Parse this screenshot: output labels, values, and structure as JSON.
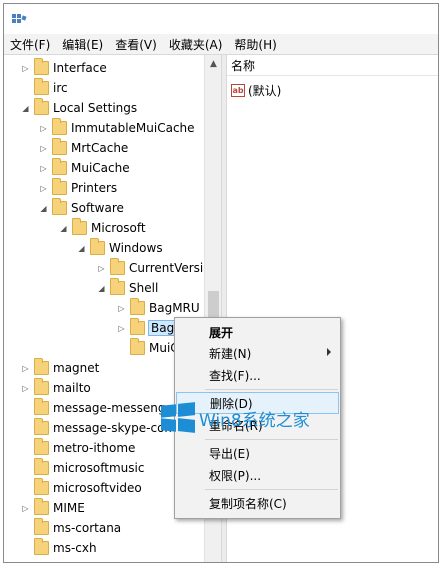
{
  "menubar": {
    "items": [
      "文件(F)",
      "编辑(E)",
      "查看(V)",
      "收藏夹(A)",
      "帮助(H)"
    ]
  },
  "tree": {
    "items": [
      {
        "label": "Interface",
        "expander": "right"
      },
      {
        "label": "irc",
        "expander": "none"
      },
      {
        "label": "Local Settings",
        "expander": "down"
      },
      {
        "label": "ImmutableMuiCache",
        "expander": "right"
      },
      {
        "label": "MrtCache",
        "expander": "right"
      },
      {
        "label": "MuiCache",
        "expander": "right"
      },
      {
        "label": "Printers",
        "expander": "right"
      },
      {
        "label": "Software",
        "expander": "down"
      },
      {
        "label": "Microsoft",
        "expander": "down"
      },
      {
        "label": "Windows",
        "expander": "down"
      },
      {
        "label": "CurrentVersic",
        "expander": "right"
      },
      {
        "label": "Shell",
        "expander": "down"
      },
      {
        "label": "BagMRU",
        "expander": "right"
      },
      {
        "label": "Bags",
        "expander": "right",
        "selected": true
      },
      {
        "label": "MuiC",
        "expander": "none"
      },
      {
        "label": "magnet",
        "expander": "right"
      },
      {
        "label": "mailto",
        "expander": "right"
      },
      {
        "label": "message-messenger",
        "expander": "none"
      },
      {
        "label": "message-skype-com",
        "expander": "none"
      },
      {
        "label": "metro-ithome",
        "expander": "none"
      },
      {
        "label": "microsoftmusic",
        "expander": "none"
      },
      {
        "label": "microsoftvideo",
        "expander": "none"
      },
      {
        "label": "MIME",
        "expander": "right"
      },
      {
        "label": "ms-cortana",
        "expander": "none"
      },
      {
        "label": "ms-cxh",
        "expander": "none"
      }
    ]
  },
  "list": {
    "column_name": "名称",
    "rows": [
      {
        "icon": "string-value-icon",
        "icon_text": "ab",
        "name": "(默认)"
      }
    ]
  },
  "context_menu": {
    "items": [
      {
        "label": "展开",
        "bold": true
      },
      {
        "label": "新建(N)",
        "submenu": true
      },
      {
        "label": "查找(F)..."
      },
      {
        "label": "删除(D)",
        "highlighted": true
      },
      {
        "label": "重命名(R)"
      },
      {
        "label": "导出(E)"
      },
      {
        "label": "权限(P)..."
      },
      {
        "label": "复制项名称(C)"
      }
    ]
  },
  "watermark": {
    "text": "Win8系统之家",
    "color": "#1d8ed6"
  },
  "colors": {
    "folder": "#f6d37a",
    "selection": "#cde8ff",
    "menu_highlight": "#e5f1fb"
  }
}
